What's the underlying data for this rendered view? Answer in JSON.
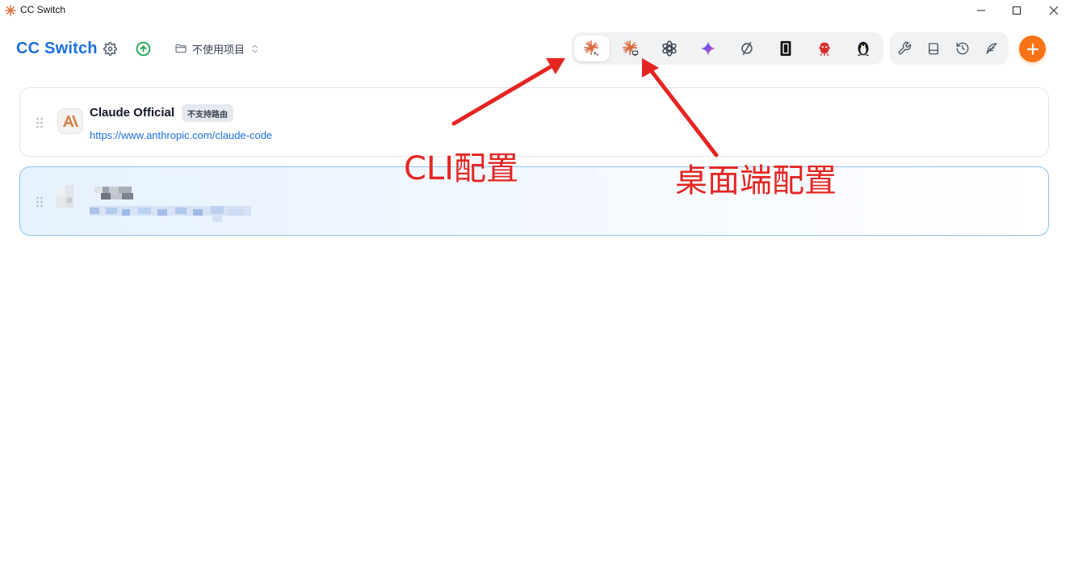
{
  "window": {
    "title": "CC Switch",
    "controls": [
      "minimize-icon",
      "maximize-icon",
      "close-icon"
    ]
  },
  "header": {
    "brand": "CC Switch",
    "settings_icon": "gear-icon",
    "update_icon": "arrow-up-circle-icon",
    "project_selector": {
      "icon": "folder-icon",
      "value": "不使用项目",
      "caret_icon": "chevron-updown-icon"
    }
  },
  "app_tabs": [
    {
      "icon": "claude-cli-icon",
      "active": true
    },
    {
      "icon": "claude-desktop-icon",
      "active": false
    },
    {
      "icon": "openai-icon",
      "active": false
    },
    {
      "icon": "gemini-icon",
      "active": false
    },
    {
      "icon": "opencode-icon",
      "active": false
    },
    {
      "icon": "terminal-block-icon",
      "active": false
    },
    {
      "icon": "red-mascot-icon",
      "active": false
    },
    {
      "icon": "penguin-icon",
      "active": false
    }
  ],
  "tools": [
    {
      "icon": "wrench-icon"
    },
    {
      "icon": "book-icon"
    },
    {
      "icon": "history-icon"
    },
    {
      "icon": "feather-icon"
    }
  ],
  "add_button_icon": "plus-icon",
  "providers": [
    {
      "name": "Claude Official",
      "badge": "不支持路由",
      "url": "https://www.anthropic.com/claude-code",
      "logo_icon": "anthropic-logo-icon",
      "selected": false
    },
    {
      "selected": true,
      "redacted": true
    }
  ],
  "annotations": {
    "cli_label": "CLI配置",
    "desktop_label": "桌面端配置",
    "color": "#e52521"
  },
  "colors": {
    "brand": "#1d6fe0",
    "accent": "#f97316",
    "link": "#1d6fe0",
    "update": "#16a34a"
  }
}
